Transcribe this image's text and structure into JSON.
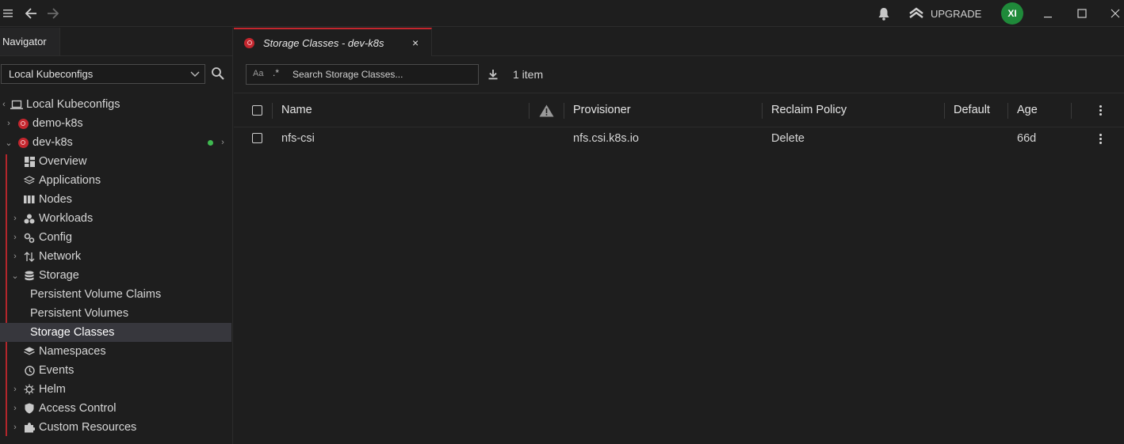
{
  "topbar": {
    "upgrade_label": "UPGRADE",
    "avatar_initials": "XI"
  },
  "navigator": {
    "title": "Navigator",
    "kubeconfig_select": "Local Kubeconfigs",
    "tree": {
      "root": "Local Kubeconfigs",
      "cluster_1": "demo-k8s",
      "cluster_2": "dev-k8s",
      "items": [
        "Overview",
        "Applications",
        "Nodes",
        "Workloads",
        "Config",
        "Network",
        "Storage",
        "Persistent Volume Claims",
        "Persistent Volumes",
        "Storage Classes",
        "Namespaces",
        "Events",
        "Helm",
        "Access Control",
        "Custom Resources"
      ]
    }
  },
  "tab": {
    "label": "Storage Classes - dev-k8s",
    "close": "×"
  },
  "toolbar": {
    "case_toggle": "Aa",
    "regex_toggle": ".*",
    "search_placeholder": "Search Storage Classes...",
    "item_count": "1 item"
  },
  "table": {
    "headers": {
      "name": "Name",
      "provisioner": "Provisioner",
      "reclaim_policy": "Reclaim Policy",
      "default": "Default",
      "age": "Age"
    },
    "rows": [
      {
        "name": "nfs-csi",
        "provisioner": "nfs.csi.k8s.io",
        "reclaim_policy": "Delete",
        "default": "",
        "age": "66d"
      }
    ]
  },
  "colors": {
    "accent_red": "#c4262e",
    "status_green": "#3fb950",
    "avatar_green": "#1f8a3a"
  }
}
